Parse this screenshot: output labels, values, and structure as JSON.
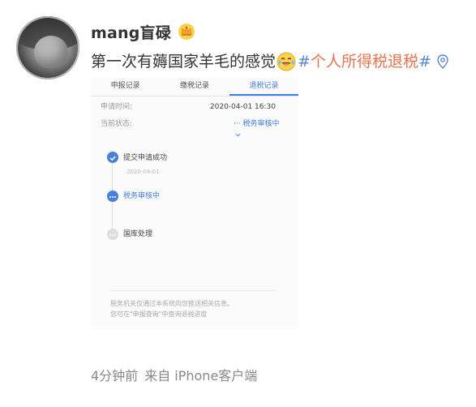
{
  "user": {
    "name": "mang盲碌",
    "avatar_icon": "user-avatar",
    "badge_icon": "crown-icon"
  },
  "post": {
    "text": "第一次有薅国家羊毛的感觉",
    "emoji_icon": "laugh-cry-icon",
    "hashtag_open": "#",
    "hashtag_text": "个人所得税退税",
    "hashtag_close": "#",
    "location_icon": "location-pin-icon"
  },
  "screenshot": {
    "tabs": [
      {
        "label": "申报记录"
      },
      {
        "label": "缴税记录"
      },
      {
        "label": "退税记录"
      }
    ],
    "active_tab": "退税记录",
    "apply_time_label": "申请时间:",
    "apply_time_value": "2020-04-01 16:30",
    "status_label": "当前状态:",
    "status_value": "··· 税务审核中",
    "timeline": [
      {
        "title": "提交申请成功",
        "date": "2020-04-01",
        "state": "done"
      },
      {
        "title": "税务审核中",
        "state": "current"
      },
      {
        "title": "国库处理",
        "state": "pending"
      }
    ],
    "notice_line1": "税务机关仅通过本系统向您推送相关信息。",
    "notice_line2": "您可在\"申报查询\"中查询退税进度"
  },
  "footer": {
    "time": "4分钟前",
    "source": "来自 iPhone客户端"
  },
  "colors": {
    "link_blue": "#5a85d6",
    "hashtag": "#eb7350",
    "app_blue": "#3f7fe0"
  }
}
